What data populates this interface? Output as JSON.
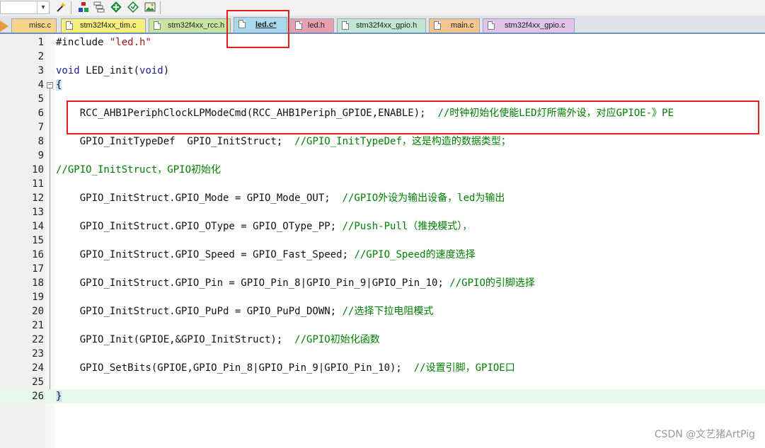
{
  "tabs": [
    {
      "label": "misc.c",
      "color": "#f6d58a",
      "active": false
    },
    {
      "label": "stm32f4xx_tim.c",
      "color": "#f7f07a",
      "active": false
    },
    {
      "label": "stm32f4xx_rcc.h",
      "color": "#c8e6a0",
      "active": false
    },
    {
      "label": "led.c*",
      "color": "#a8d8ea",
      "active": true
    },
    {
      "label": "led.h",
      "color": "#e8a0b0",
      "active": false
    },
    {
      "label": "stm32f4xx_gpio.h",
      "color": "#bfe6d2",
      "active": false
    },
    {
      "label": "main.c",
      "color": "#f3c48c",
      "active": false
    },
    {
      "label": "stm32f4xx_gpio.c",
      "color": "#e2c4e8",
      "active": false
    }
  ],
  "toolbar": {
    "icons": [
      "dropdown-arrow-icon",
      "wand-icon",
      "build-stack-icon",
      "layers-icon",
      "diamond-green-icon",
      "diamond-outline-icon",
      "image-chip-icon"
    ]
  },
  "code_lines": [
    {
      "n": "1",
      "segments": [
        {
          "t": "#include ",
          "c": "pp"
        },
        {
          "t": "\"led.h\"",
          "c": "str"
        }
      ]
    },
    {
      "n": "2",
      "segments": []
    },
    {
      "n": "3",
      "segments": [
        {
          "t": "void",
          "c": "kw"
        },
        {
          "t": " LED_init(",
          "c": "plain"
        },
        {
          "t": "void",
          "c": "kw"
        },
        {
          "t": ")",
          "c": "plain"
        }
      ]
    },
    {
      "n": "4",
      "segments": [
        {
          "t": "{",
          "c": "brace"
        }
      ]
    },
    {
      "n": "5",
      "segments": []
    },
    {
      "n": "6",
      "segments": [
        {
          "t": "    RCC_AHB1PeriphClockLPModeCmd(RCC_AHB1Periph_GPIOE,ENABLE);  ",
          "c": "plain"
        },
        {
          "t": "//时钟初始化使能LED灯所需外设，对应GPIOE-》PE",
          "c": "cmt"
        }
      ]
    },
    {
      "n": "7",
      "segments": []
    },
    {
      "n": "8",
      "segments": [
        {
          "t": "    GPIO_InitTypeDef  GPIO_InitStruct;  ",
          "c": "plain"
        },
        {
          "t": "//GPIO_InitTypeDef，这是构造的数据类型；",
          "c": "cmt"
        }
      ]
    },
    {
      "n": "9",
      "segments": []
    },
    {
      "n": "10",
      "segments": [
        {
          "t": "//GPIO_InitStruct，GPIO初始化",
          "c": "cmt"
        }
      ]
    },
    {
      "n": "11",
      "segments": []
    },
    {
      "n": "12",
      "segments": [
        {
          "t": "    GPIO_InitStruct.GPIO_Mode = GPIO_Mode_OUT;  ",
          "c": "plain"
        },
        {
          "t": "//GPIO外设为输出设备，led为输出",
          "c": "cmt"
        }
      ]
    },
    {
      "n": "13",
      "segments": []
    },
    {
      "n": "14",
      "segments": [
        {
          "t": "    GPIO_InitStruct.GPIO_OType = GPIO_OType_PP; ",
          "c": "plain"
        },
        {
          "t": "//Push-Pull（推挽模式），",
          "c": "cmt"
        }
      ]
    },
    {
      "n": "15",
      "segments": []
    },
    {
      "n": "16",
      "segments": [
        {
          "t": "    GPIO_InitStruct.GPIO_Speed = GPIO_Fast_Speed; ",
          "c": "plain"
        },
        {
          "t": "//GPIO_Speed的速度选择",
          "c": "cmt"
        }
      ]
    },
    {
      "n": "17",
      "segments": []
    },
    {
      "n": "18",
      "segments": [
        {
          "t": "    GPIO_InitStruct.GPIO_Pin = GPIO_Pin_8|GPIO_Pin_9|GPIO_Pin_10; ",
          "c": "plain"
        },
        {
          "t": "//GPIO的引脚选择",
          "c": "cmt"
        }
      ]
    },
    {
      "n": "19",
      "segments": []
    },
    {
      "n": "20",
      "segments": [
        {
          "t": "    GPIO_InitStruct.GPIO_PuPd = GPIO_PuPd_DOWN; ",
          "c": "plain"
        },
        {
          "t": "//选择下拉电阻模式",
          "c": "cmt"
        }
      ]
    },
    {
      "n": "21",
      "segments": []
    },
    {
      "n": "22",
      "segments": [
        {
          "t": "    GPIO_Init(GPIOE,&GPIO_InitStruct);  ",
          "c": "plain"
        },
        {
          "t": "//GPIO初始化函数",
          "c": "cmt"
        }
      ]
    },
    {
      "n": "23",
      "segments": []
    },
    {
      "n": "24",
      "segments": [
        {
          "t": "    GPIO_SetBits(GPIOE,GPIO_Pin_8|GPIO_Pin_9|GPIO_Pin_10);  ",
          "c": "plain"
        },
        {
          "t": "//设置引脚，GPIOE口",
          "c": "cmt"
        }
      ]
    },
    {
      "n": "25",
      "segments": []
    },
    {
      "n": "26",
      "segments": [
        {
          "t": "}",
          "c": "brace"
        }
      ]
    }
  ],
  "current_line": "26",
  "watermark": "CSDN @文艺猪ArtPig",
  "colors": {
    "keyword": "#1a1aa6",
    "string": "#a31515",
    "comment": "#008000",
    "annotation": "#e02020",
    "current_line_bg": "#e8f8ea"
  }
}
